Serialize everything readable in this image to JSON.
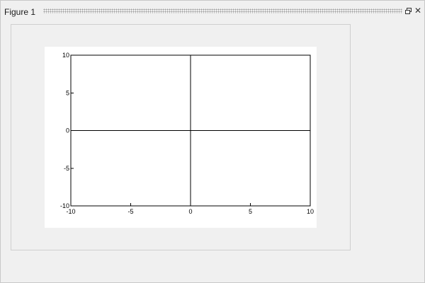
{
  "window": {
    "title": "Figure 1",
    "undock_icon": "undock-icon",
    "close_icon": "close-icon",
    "close_glyph": "✕"
  },
  "chart_data": {
    "type": "line",
    "title": "",
    "xlabel": "",
    "ylabel": "",
    "xlim": [
      -10,
      10
    ],
    "ylim": [
      -10,
      10
    ],
    "x_ticks": [
      -10,
      -5,
      0,
      5,
      10
    ],
    "y_ticks": [
      -10,
      -5,
      0,
      5,
      10
    ],
    "x_tick_labels": [
      "-10",
      "-5",
      "0",
      "5",
      "10"
    ],
    "y_tick_labels": [
      "-10",
      "-5",
      "0",
      "5",
      "10"
    ],
    "grid": false,
    "series": [],
    "reference_lines": [
      {
        "orientation": "horizontal",
        "value": 0
      },
      {
        "orientation": "vertical",
        "value": 0
      }
    ],
    "colors": {
      "axes": "#000000",
      "background": "#ffffff"
    }
  }
}
